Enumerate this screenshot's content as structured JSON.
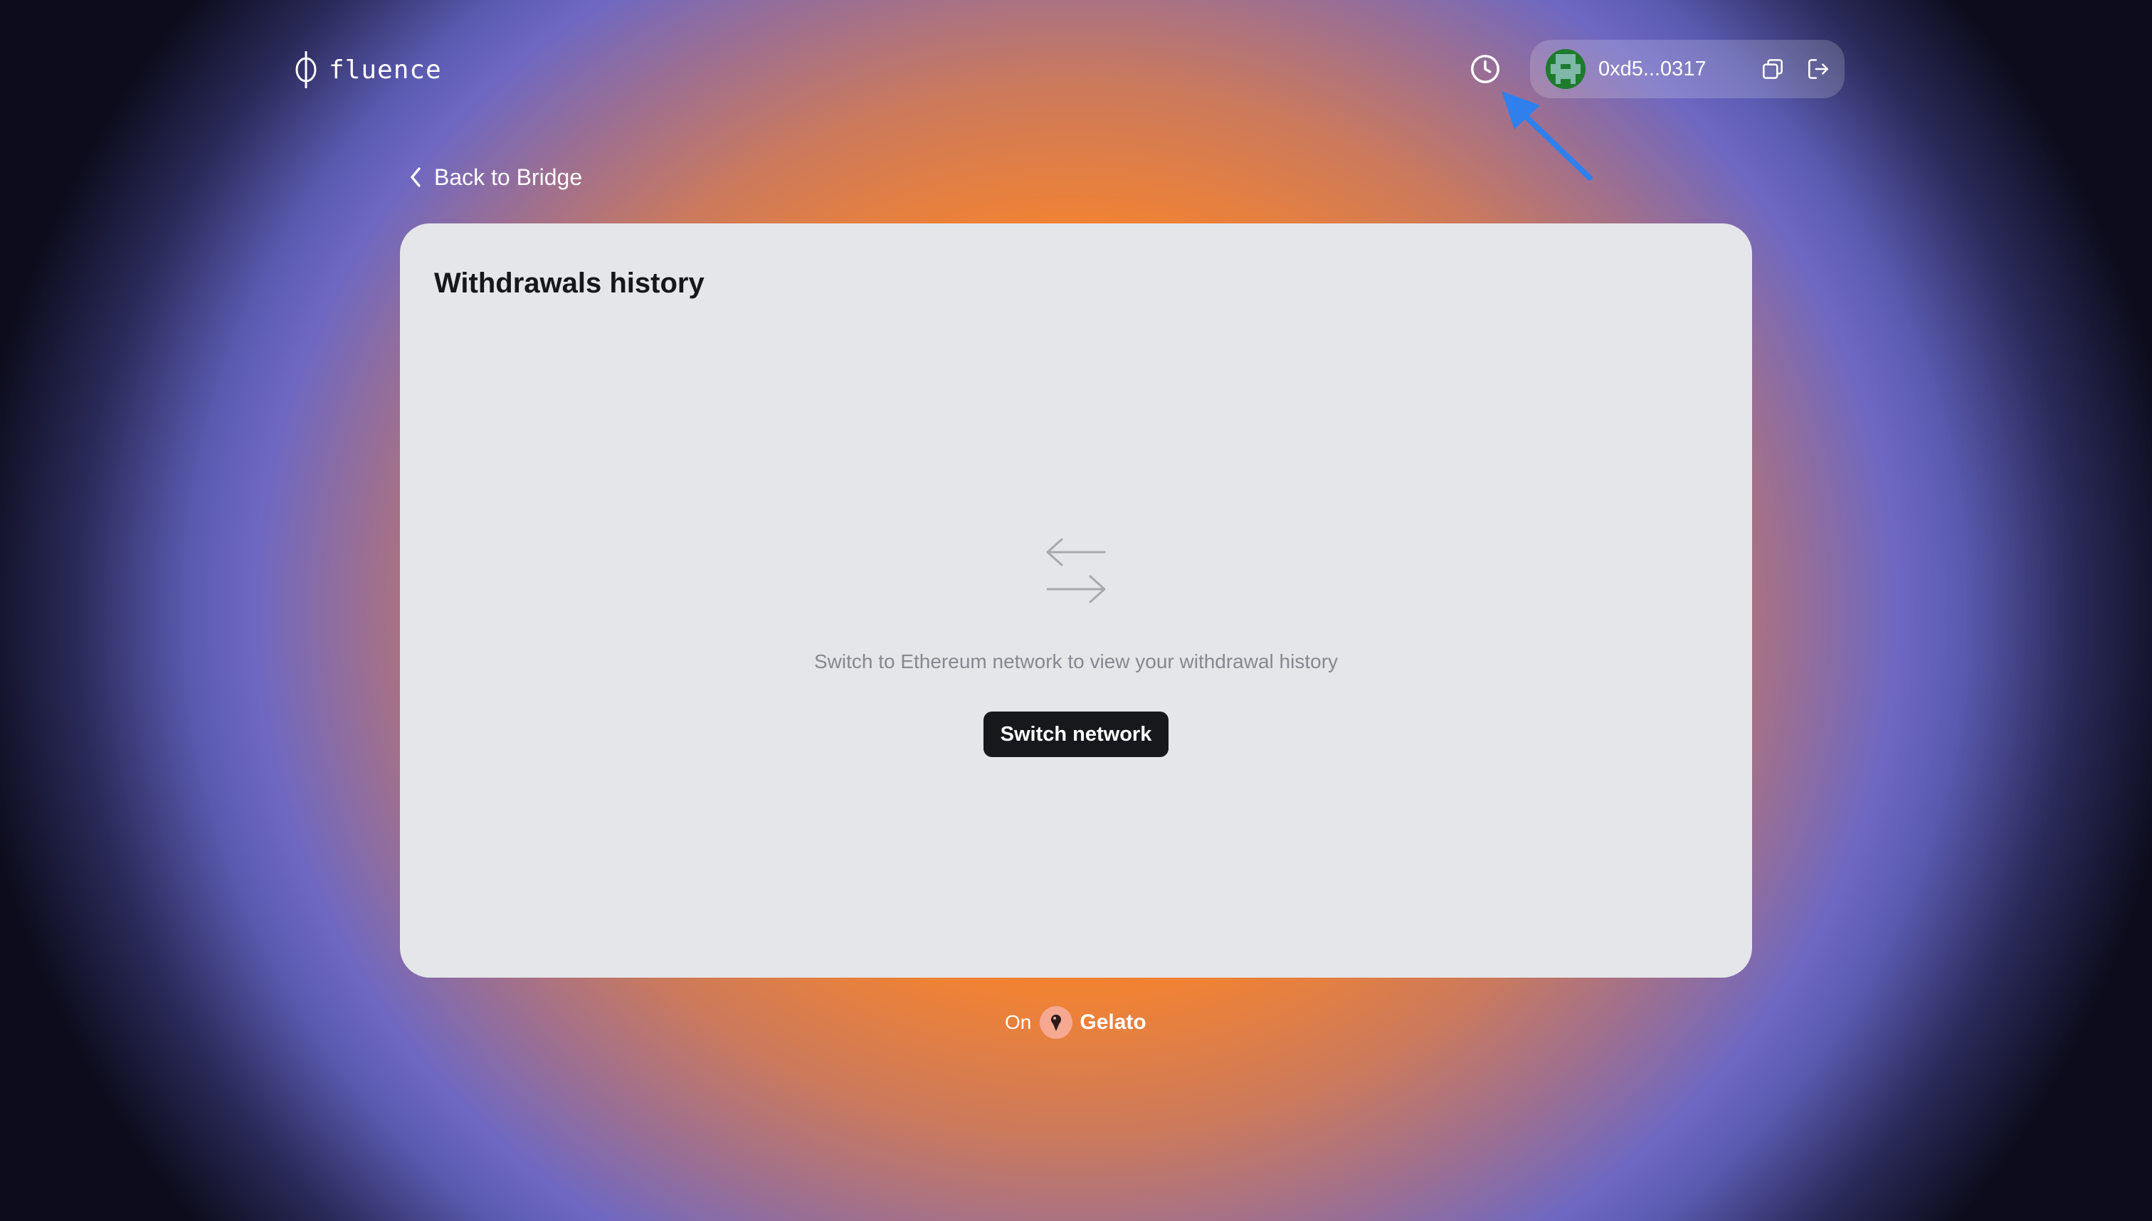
{
  "header": {
    "logo_text": "fluence",
    "wallet": {
      "address": "0xd5...0317"
    }
  },
  "nav": {
    "back_label": "Back to Bridge"
  },
  "card": {
    "title": "Withdrawals history",
    "empty_message": "Switch to Ethereum network to view your withdrawal history",
    "switch_button_label": "Switch network"
  },
  "footer": {
    "prefix": "On",
    "brand": "Gelato"
  },
  "icons": {
    "history": "clock-icon",
    "copy": "copy-icon",
    "logout": "logout-icon",
    "back": "chevron-left-icon",
    "empty_state": "swap-arrows-icon",
    "annotation": "arrow-annotation"
  },
  "colors": {
    "background_center": "#ff6a00",
    "background_edge": "#6e68c2",
    "card_background": "#e5e6e9",
    "button_background": "#17181b",
    "annotation_arrow": "#2f80ed"
  }
}
